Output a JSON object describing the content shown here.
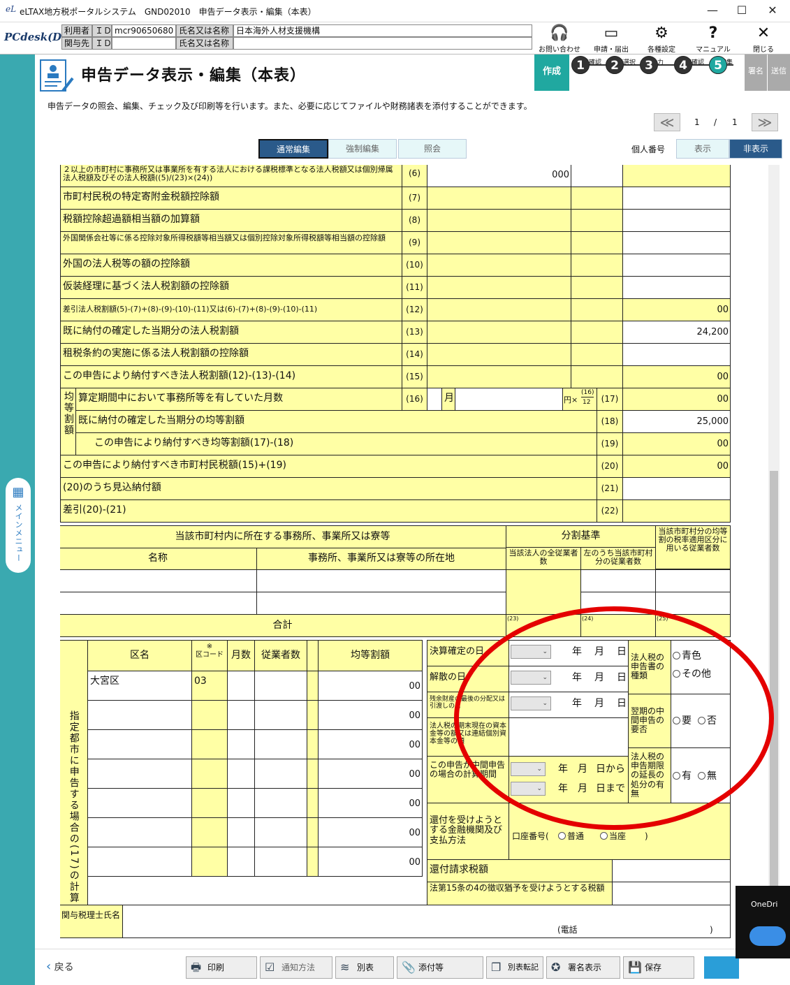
{
  "window": {
    "title": "eLTAX地方税ポータルシステム　GND02010　申告データ表示・編集（本表）",
    "minimize": "—",
    "maximize": "☐",
    "close": "✕"
  },
  "userbar": {
    "product": "PCdesk(DL版)",
    "user_label": "利用者",
    "kanyo_label": "関与先",
    "id_label": "ＩＤ",
    "user_id": "mcr90650680",
    "name_label": "氏名又は名称",
    "user_name": "日本海外人材支援機構",
    "kanyo_id": "",
    "kanyo_name": ""
  },
  "tools": [
    {
      "label": "お問い合わせ",
      "icon": "headset-icon"
    },
    {
      "label": "申請・届出",
      "icon": "window-icon"
    },
    {
      "label": "各種設定",
      "icon": "gear-icon"
    },
    {
      "label": "マニュアル",
      "icon": "question-icon"
    },
    {
      "label": "閉じる",
      "icon": "close-icon"
    }
  ],
  "side_menu": {
    "label": "メインメニュー"
  },
  "header": {
    "title": "申告データ表示・編集（本表）",
    "create_label": "作成",
    "signature": "署名",
    "send": "送信",
    "steps": [
      {
        "n": "1",
        "label": "事前確認"
      },
      {
        "n": "2",
        "label": "手続選択"
      },
      {
        "n": "3",
        "label": "入力"
      },
      {
        "n": "4",
        "label": "内容確認"
      },
      {
        "n": "5",
        "label": "編集"
      }
    ]
  },
  "description": "申告データの照会、編集、チェック及び印刷等を行います。また、必要に応じてファイルや財務諸表を添付することができます。",
  "pager": {
    "prev": "≪",
    "next": "≫",
    "current": "1",
    "sep": "/",
    "total": "1"
  },
  "modes": {
    "normal": "通常編集",
    "forced": "強制編集",
    "inquiry": "照会"
  },
  "kojin": {
    "label": "個人番号",
    "show": "表示",
    "hide": "非表示"
  },
  "rows": [
    {
      "label": "２以上の市町村に事務所又は事業所を有する法人における課税標準となる法人税額又は個別帰属法人税額及びその法人税額((5)/(23)×(24))",
      "num": "(6)",
      "mid": "000",
      "val": ""
    },
    {
      "label": "市町村民税の特定寄附金税額控除額",
      "num": "(7)",
      "mid": "",
      "val": ""
    },
    {
      "label": "税額控除超過額相当額の加算額",
      "num": "(8)",
      "mid": "",
      "val": ""
    },
    {
      "label": "外国関係会社等に係る控除対象所得税額等相当額又は個別控除対象所得税額等相当額の控除額",
      "num": "(9)",
      "mid": "",
      "val": ""
    },
    {
      "label": "外国の法人税等の額の控除額",
      "num": "(10)",
      "mid": "",
      "val": ""
    },
    {
      "label": "仮装経理に基づく法人税割額の控除額",
      "num": "(11)",
      "mid": "",
      "val": ""
    },
    {
      "label": "差引法人税割額(5)-(7)+(8)-(9)-(10)-(11)又は(6)-(7)+(8)-(9)-(10)-(11)",
      "num": "(12)",
      "mid": "",
      "val": "00"
    },
    {
      "label": "既に納付の確定した当期分の法人税割額",
      "num": "(13)",
      "mid": "",
      "val": "24,200"
    },
    {
      "label": "租税条約の実施に係る法人税割額の控除額",
      "num": "(14)",
      "mid": "",
      "val": ""
    },
    {
      "label": "この申告により納付すべき法人税割額(12)-(13)-(14)",
      "num": "(15)",
      "mid": "",
      "val": "00"
    }
  ],
  "kinto": {
    "side": "均等割額",
    "months_label": "算定期間中において事務所等を有していた月数",
    "months_num": "(16)",
    "month_unit": "月",
    "yen_x": "円×",
    "frac_top": "(16)",
    "frac_bot": "12",
    "n17": "(17)",
    "v17": "00",
    "paid_label": "既に納付の確定した当期分の均等割額",
    "n18": "(18)",
    "v18": "25,000",
    "due_label": "この申告により納付すべき均等割額(17)-(18)",
    "n19": "(19)",
    "v19": "00"
  },
  "rows2": [
    {
      "label": "この申告により納付すべき市町村民税額(15)+(19)",
      "num": "(20)",
      "val": "00"
    },
    {
      "label": "(20)のうち見込納付額",
      "num": "(21)",
      "val": ""
    },
    {
      "label": "差引(20)-(21)",
      "num": "(22)",
      "val": ""
    }
  ],
  "office": {
    "head": "当該市町村内に所在する事務所、事業所又は寮等",
    "bunkatsu": "分割基準",
    "kinto_head": "当該市町村分の均等割の税率適用区分に用いる従業者数",
    "name": "名称",
    "location": "事務所、事業所又は寮等の所在地",
    "all_emp": "当該法人の全従業者数",
    "town_emp": "左のうち当該市町村分の従業者数",
    "total": "合計",
    "n23": "(23)",
    "n24": "(24)",
    "n25": "(25)"
  },
  "ward": {
    "side": "指定都市に申告する場合の(17)の計算",
    "name": "区名",
    "note": "※",
    "code": "区コード",
    "months": "月数",
    "emp": "従業者数",
    "amount": "均等割額",
    "rows": [
      {
        "name": "大宮区",
        "code": "03",
        "amt": "00"
      },
      {
        "name": "",
        "code": "",
        "amt": "00"
      },
      {
        "name": "",
        "code": "",
        "amt": "00"
      },
      {
        "name": "",
        "code": "",
        "amt": "00"
      },
      {
        "name": "",
        "code": "",
        "amt": "00"
      },
      {
        "name": "",
        "code": "",
        "amt": "00"
      },
      {
        "name": "",
        "code": "",
        "amt": "00"
      }
    ]
  },
  "right": {
    "kessan": "決算確定の日",
    "kaisan": "解散の日",
    "zanyo": "残余財産の最後の分配又は引渡しの日",
    "shihon": "法人税の期末現在の資本金等の額又は連結個別資本金等の額",
    "chukan": "この申告が中間申告の場合の計算期間",
    "y": "年",
    "m": "月",
    "d": "日",
    "d_from": "日から",
    "d_to": "日まで",
    "shurui": "法人税の申告書の種類",
    "blue": "青色",
    "other": "その他",
    "yohi": "翌期の中間申告の要否",
    "yes_need": "要",
    "no_need": "否",
    "encho": "法人税の申告期限の延長の処分の有無",
    "yes": "有",
    "no": "無",
    "kanpu": "還付を受けようとする金融機関及び支払方法",
    "koza": "口座番号(",
    "futsu": "普通",
    "toza": "当座",
    "close_paren": ")",
    "kanpu_tax": "還付請求税額",
    "yuyo": "法第15条の4の徴収猶予を受けようとする税額"
  },
  "zeirishi": {
    "label": "関与税理士氏名",
    "tel": "(電話",
    "tel_close": ")"
  },
  "bottom": {
    "back": "戻る",
    "print": "印刷",
    "notify": "通知方法",
    "beppyo": "別表",
    "attach": "添付等",
    "tenki": "別表転記",
    "sig": "署名表示",
    "save": "保存"
  },
  "onedrive": "OneDri"
}
